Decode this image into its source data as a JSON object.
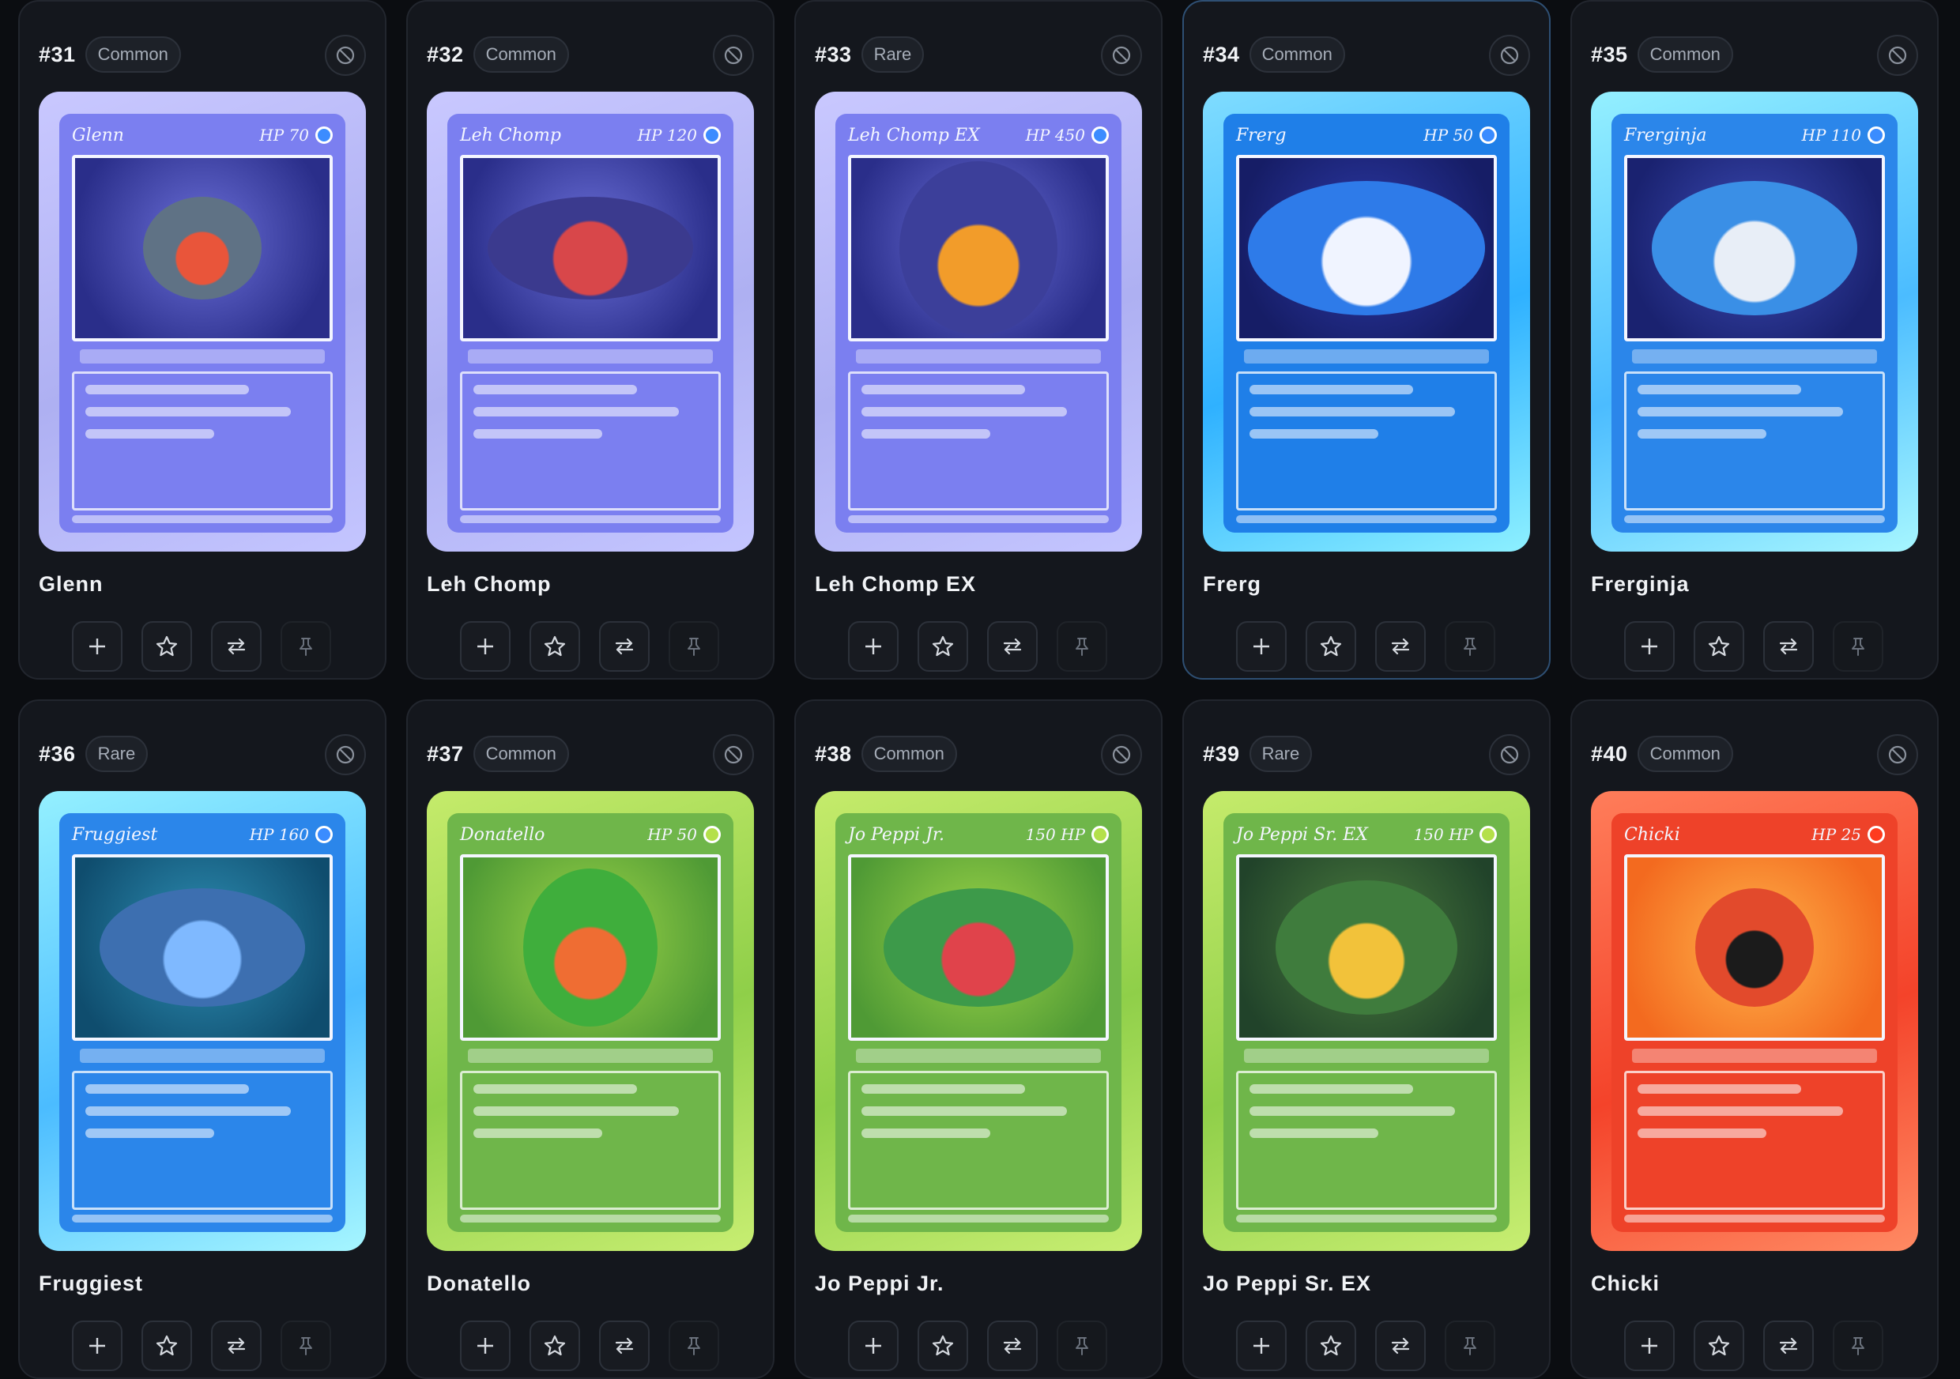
{
  "cards": [
    {
      "number": "#31",
      "rarity": "Common",
      "name": "Glenn",
      "card_title": "Glenn",
      "card_hp": "HP 70",
      "theme": "purple",
      "selected": false
    },
    {
      "number": "#32",
      "rarity": "Common",
      "name": "Leh Chomp",
      "card_title": "Leh Chomp",
      "card_hp": "HP 120",
      "theme": "purple",
      "selected": false
    },
    {
      "number": "#33",
      "rarity": "Rare",
      "name": "Leh Chomp EX",
      "card_title": "Leh Chomp EX",
      "card_hp": "HP 450",
      "theme": "purple",
      "selected": false
    },
    {
      "number": "#34",
      "rarity": "Common",
      "name": "Frerg",
      "card_title": "Frerg",
      "card_hp": "HP 50",
      "theme": "blue",
      "selected": true
    },
    {
      "number": "#35",
      "rarity": "Common",
      "name": "Frerginja",
      "card_title": "Frerginja",
      "card_hp": "HP 110",
      "theme": "cyan",
      "selected": false
    },
    {
      "number": "#36",
      "rarity": "Rare",
      "name": "Fruggiest",
      "card_title": "Fruggiest",
      "card_hp": "HP 160",
      "theme": "cyan",
      "selected": false
    },
    {
      "number": "#37",
      "rarity": "Common",
      "name": "Donatello",
      "card_title": "Donatello",
      "card_hp": "HP 50",
      "theme": "green",
      "selected": false
    },
    {
      "number": "#38",
      "rarity": "Common",
      "name": "Jo Peppi Jr.",
      "card_title": "Jo Peppi Jr.",
      "card_hp": "150 HP",
      "theme": "green",
      "selected": false
    },
    {
      "number": "#39",
      "rarity": "Rare",
      "name": "Jo Peppi Sr. EX",
      "card_title": "Jo Peppi Sr. EX",
      "card_hp": "150 HP",
      "theme": "green",
      "selected": false
    },
    {
      "number": "#40",
      "rarity": "Common",
      "name": "Chicki",
      "card_title": "Chicki",
      "card_hp": "HP 25",
      "theme": "red",
      "selected": false
    }
  ],
  "icons": {
    "hide": "hide-icon",
    "add": "plus-icon",
    "favorite": "star-icon",
    "trade": "swap-icon",
    "pin": "pin-icon"
  },
  "colors": {
    "background": "#0b0d11",
    "tile": "#14171d",
    "selected_border": "#2e4f73"
  }
}
